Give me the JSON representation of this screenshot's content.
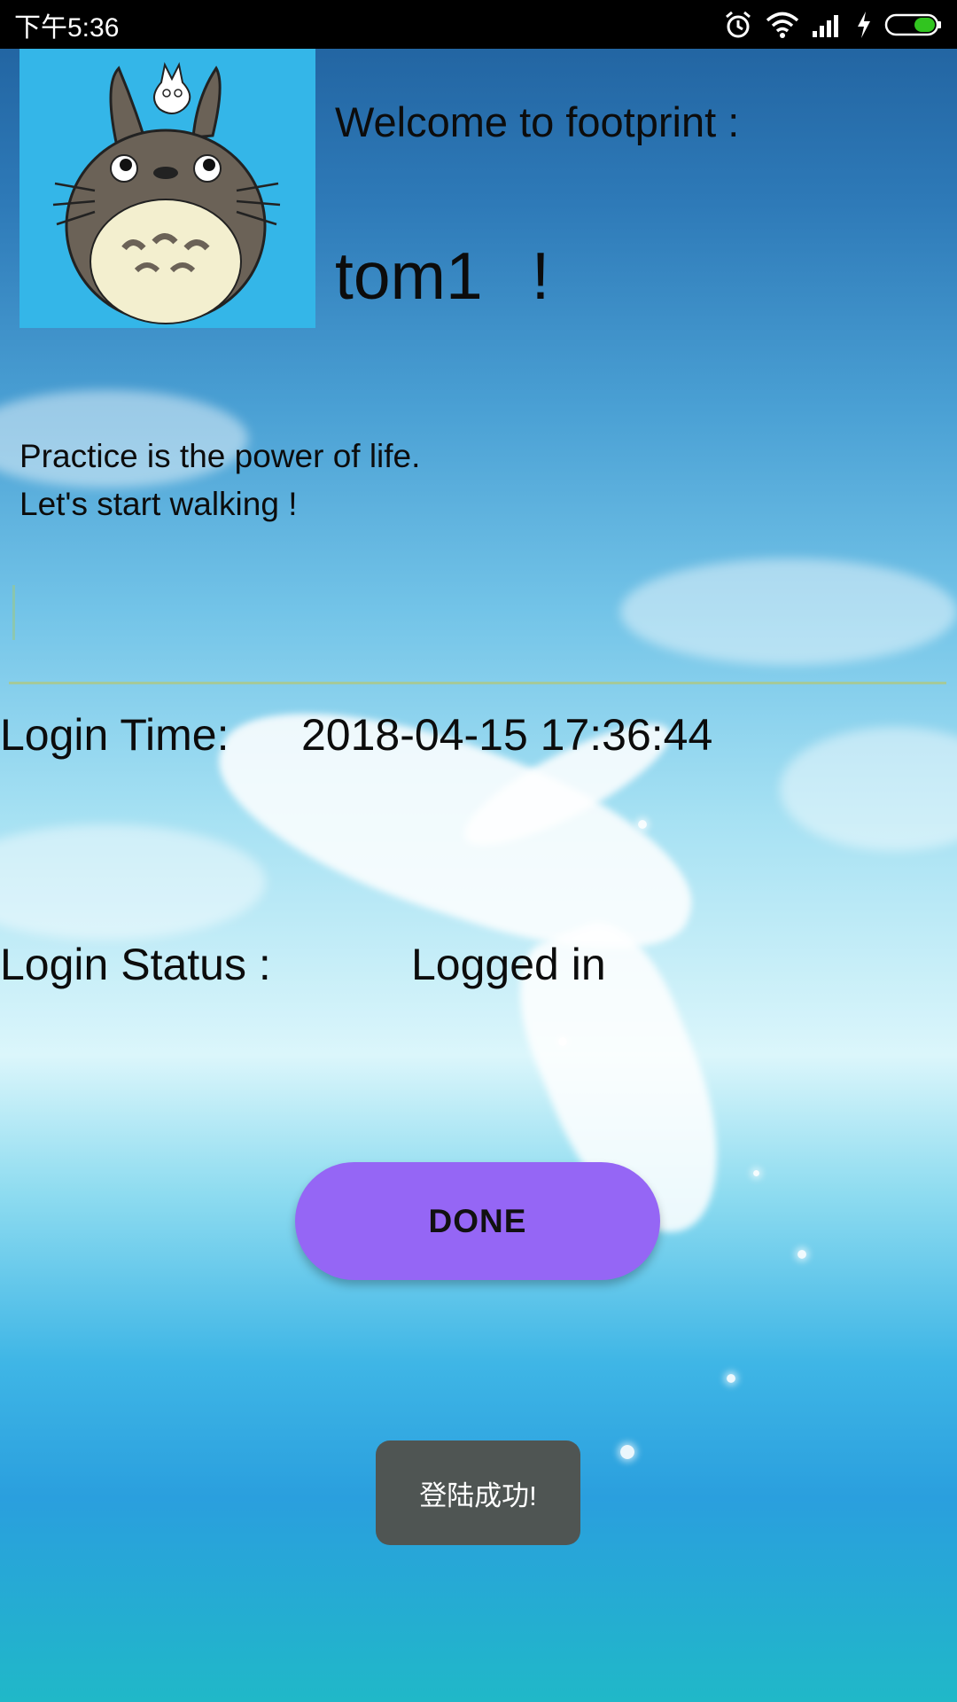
{
  "status_bar": {
    "time": "下午5:36",
    "icons": [
      "alarm-icon",
      "wifi-icon",
      "signal-icon",
      "charging-icon",
      "battery-icon"
    ],
    "battery_color": "#31c41f"
  },
  "header": {
    "welcome": "Welcome to footprint :",
    "username": "tom1",
    "exclamation": "!"
  },
  "quote": {
    "line1": "Practice is the power of life.",
    "line2": "Let's start walking !"
  },
  "input": {
    "value": ""
  },
  "login_time": {
    "label": "Login Time:",
    "value": "2018-04-15 17:36:44"
  },
  "login_status": {
    "label": "Login Status :",
    "value": "Logged in"
  },
  "done_button": {
    "label": "DONE",
    "color": "#9566f5"
  },
  "toast": {
    "message": "登陆成功!"
  }
}
